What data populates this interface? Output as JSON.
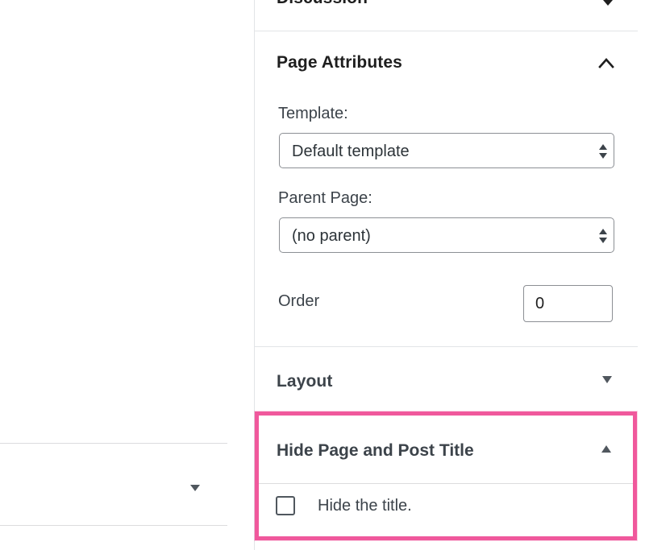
{
  "sidebar": {
    "discussion": {
      "title": "Discussion"
    },
    "page_attributes": {
      "title": "Page Attributes",
      "template_label": "Template:",
      "template_value": "Default template",
      "parent_label": "Parent Page:",
      "parent_value": "(no parent)",
      "order_label": "Order",
      "order_value": "0"
    },
    "layout": {
      "title": "Layout"
    },
    "hide_title_panel": {
      "title": "Hide Page and Post Title",
      "checkbox_label": "Hide the title.",
      "checked": false,
      "highlight_color": "#f0589c"
    }
  },
  "icons": {
    "discussion_toggle": "chevron-down-icon",
    "page_attributes_toggle": "chevron-up-icon",
    "select_arrows": "select-arrows-icon",
    "layout_toggle": "triangle-down-icon",
    "hide_title_toggle": "triangle-up-icon",
    "left_panel_toggle": "triangle-down-icon"
  }
}
